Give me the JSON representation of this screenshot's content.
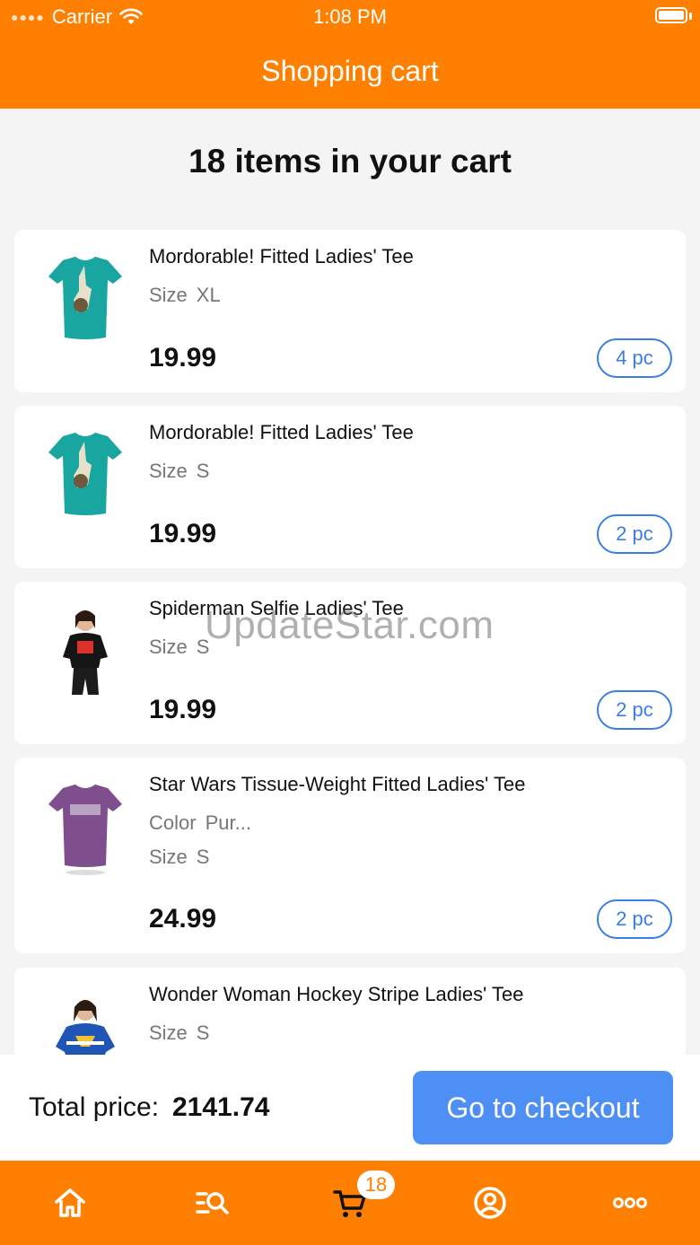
{
  "status_bar": {
    "carrier": "Carrier",
    "time": "1:08 PM"
  },
  "header": {
    "title": "Shopping cart"
  },
  "cart": {
    "heading": "18 items in your cart",
    "items": [
      {
        "name": "Mordorable! Fitted Ladies' Tee",
        "attrs": [
          {
            "label": "Size",
            "value": "XL"
          }
        ],
        "price": "19.99",
        "qty": "4 pc",
        "thumb": "teal-tee-icon"
      },
      {
        "name": "Mordorable! Fitted Ladies' Tee",
        "attrs": [
          {
            "label": "Size",
            "value": "S"
          }
        ],
        "price": "19.99",
        "qty": "2 pc",
        "thumb": "teal-tee-icon"
      },
      {
        "name": "Spiderman Selfie Ladies' Tee",
        "attrs": [
          {
            "label": "Size",
            "value": "S"
          }
        ],
        "price": "19.99",
        "qty": "2 pc",
        "thumb": "model-black-tee-icon"
      },
      {
        "name": "Star Wars Tissue-Weight Fitted Ladies' Tee",
        "attrs": [
          {
            "label": "Color",
            "value": "Pur..."
          },
          {
            "label": "Size",
            "value": "S"
          }
        ],
        "price": "24.99",
        "qty": "2 pc",
        "thumb": "purple-tee-icon"
      },
      {
        "name": "Wonder Woman Hockey Stripe Ladies' Tee",
        "attrs": [
          {
            "label": "Size",
            "value": "S"
          }
        ],
        "thumb": "model-blue-tee-icon"
      }
    ]
  },
  "watermark": "UpdateStar.com",
  "footer": {
    "total_label": "Total price:",
    "total_value": "2141.74",
    "checkout_label": "Go to checkout"
  },
  "tab_bar": {
    "cart_badge": "18",
    "tabs": [
      "home-icon",
      "search-list-icon",
      "cart-icon",
      "account-icon",
      "more-icon"
    ]
  },
  "colors": {
    "brand_orange": "#ff8001",
    "accent_blue": "#4d8ff5",
    "pill_blue": "#3a7ee6"
  }
}
